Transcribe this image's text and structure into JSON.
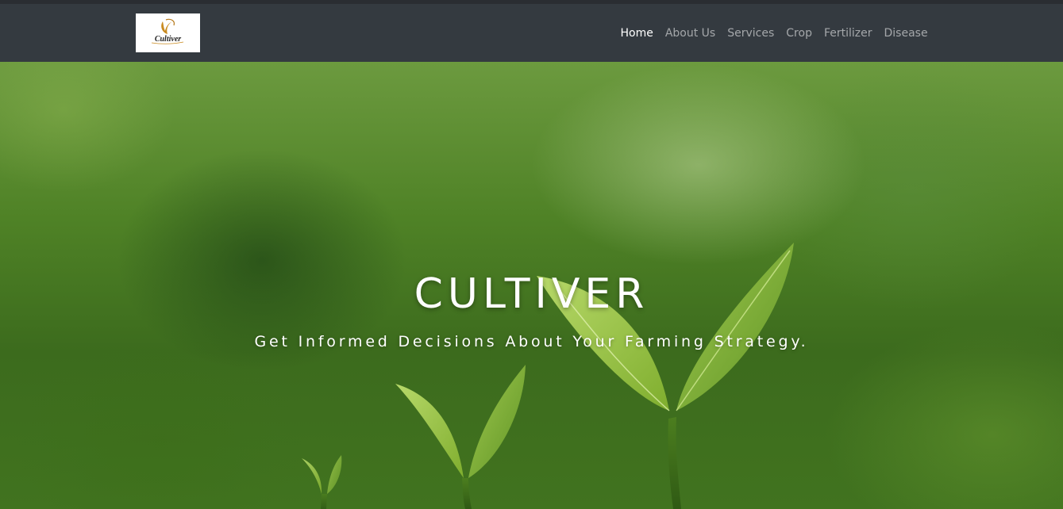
{
  "navbar": {
    "logo_text": "Cultiver",
    "items": [
      {
        "label": "Home",
        "active": true
      },
      {
        "label": "About Us",
        "active": false
      },
      {
        "label": "Services",
        "active": false
      },
      {
        "label": "Crop",
        "active": false
      },
      {
        "label": "Fertilizer",
        "active": false
      },
      {
        "label": "Disease",
        "active": false
      }
    ]
  },
  "hero": {
    "title": "CULTIVER",
    "subtitle": "Get Informed Decisions About Your Farming Strategy.",
    "background_icon": "seedling-leaves"
  },
  "colors": {
    "navbar_bg": "#343a40",
    "nav_active": "#ffffff",
    "nav_inactive": "rgba(255,255,255,0.55)",
    "hero_green": "#4f8226"
  }
}
